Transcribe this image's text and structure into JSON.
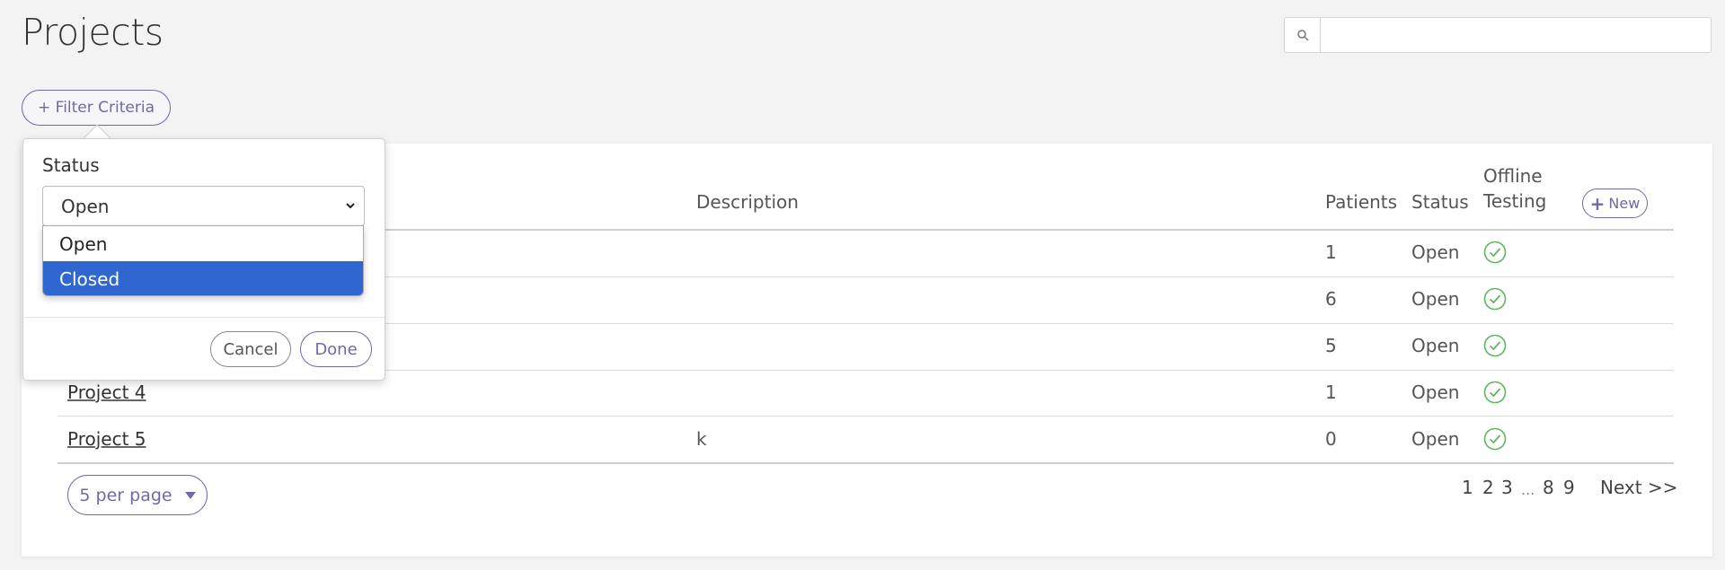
{
  "header": {
    "title": "Projects",
    "search_placeholder": ""
  },
  "filter": {
    "button_label": "+ Filter Criteria",
    "popover": {
      "field_label": "Status",
      "selected_value": "Open",
      "options": [
        "Open",
        "Closed"
      ],
      "highlighted_option": "Closed",
      "cancel_label": "Cancel",
      "done_label": "Done"
    }
  },
  "table": {
    "columns": {
      "description": "Description",
      "patients": "Patients",
      "status": "Status",
      "offline_line1": "Offline",
      "offline_line2": "Testing"
    },
    "new_button_label": "New",
    "rows": [
      {
        "name": "",
        "description": "",
        "patients": "1",
        "status": "Open",
        "offline": true
      },
      {
        "name": "",
        "description": "",
        "patients": "6",
        "status": "Open",
        "offline": true
      },
      {
        "name": "",
        "description": "",
        "patients": "5",
        "status": "Open",
        "offline": true
      },
      {
        "name": "Project 4",
        "description": "",
        "patients": "1",
        "status": "Open",
        "offline": true
      },
      {
        "name": "Project 5",
        "description": "k",
        "patients": "0",
        "status": "Open",
        "offline": true
      }
    ]
  },
  "footer": {
    "per_page_label": "5 per page",
    "pages": {
      "current": "1",
      "p2": "2",
      "p3": "3",
      "ellipsis": "...",
      "p8": "8",
      "p9": "9",
      "next": "Next >>"
    }
  },
  "colors": {
    "accent": "#6f6aa8",
    "highlight": "#2f66d0",
    "check": "#5cb85c"
  }
}
